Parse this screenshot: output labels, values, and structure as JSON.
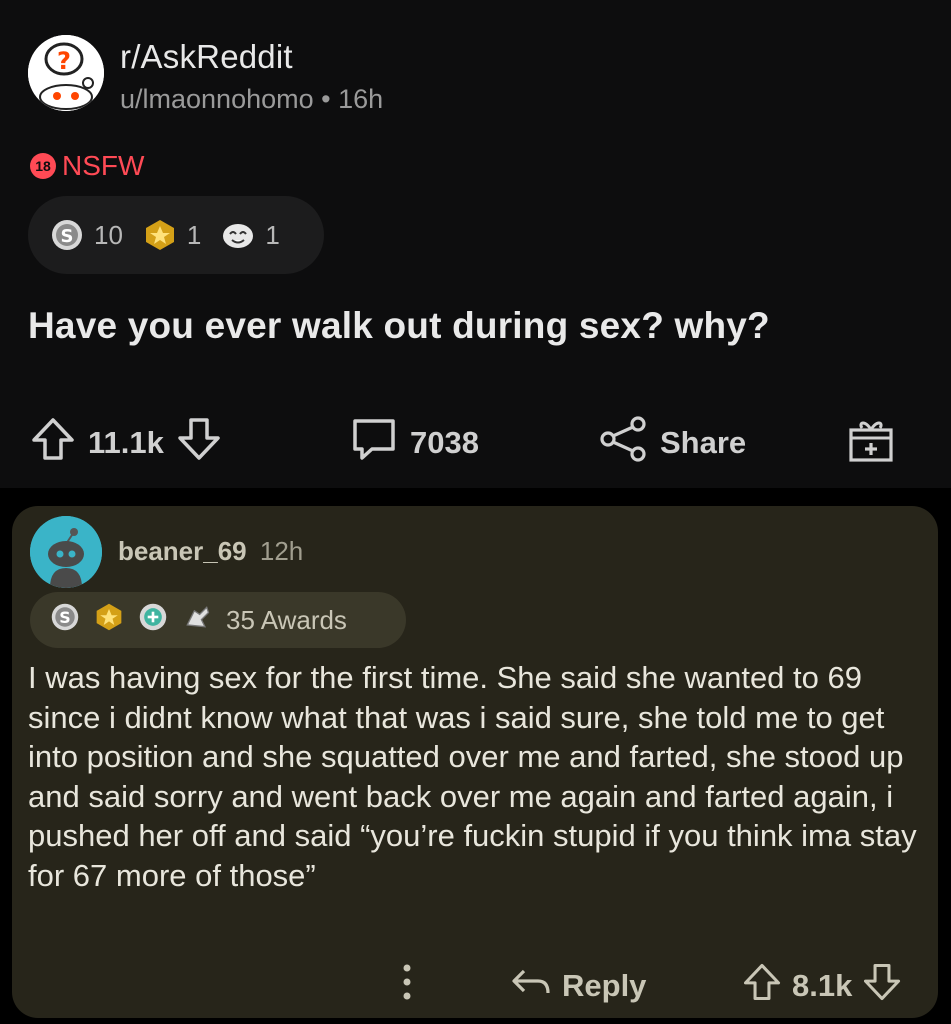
{
  "post": {
    "subreddit": "r/AskReddit",
    "author": "u/lmaonnohomo",
    "time": "16h",
    "nsfw_badge": "18",
    "nsfw_label": "NSFW",
    "awards": [
      {
        "icon": "silver-award-icon",
        "count": "10"
      },
      {
        "icon": "gold-award-icon",
        "count": "1"
      },
      {
        "icon": "laughing-face-award-icon",
        "count": "1"
      }
    ],
    "title": "Have you ever walk out during sex? why?",
    "upvotes": "11.1k",
    "comments": "7038",
    "share_label": "Share"
  },
  "comment": {
    "author": "beaner_69",
    "time": "12h",
    "awards_label": "35 Awards",
    "award_icons": [
      "silver-award-icon",
      "gold-award-icon",
      "helpful-award-icon",
      "hand-award-icon"
    ],
    "body": "I was having sex for the first time. She said she wanted to 69 since i didnt know what that was i said sure, she told me to get into position and she squatted over me and farted, she stood up and said sorry and went back over me again and farted again, i pushed her off and said “you’re fuckin stupid if you think ima stay for 67 more of those”",
    "reply_label": "Reply",
    "score": "8.1k"
  },
  "colors": {
    "post_bg": "#0d0d0e",
    "comment_bg": "#27251a",
    "nsfw": "#ff4a55",
    "avatar_teal": "#3ab4c8"
  }
}
